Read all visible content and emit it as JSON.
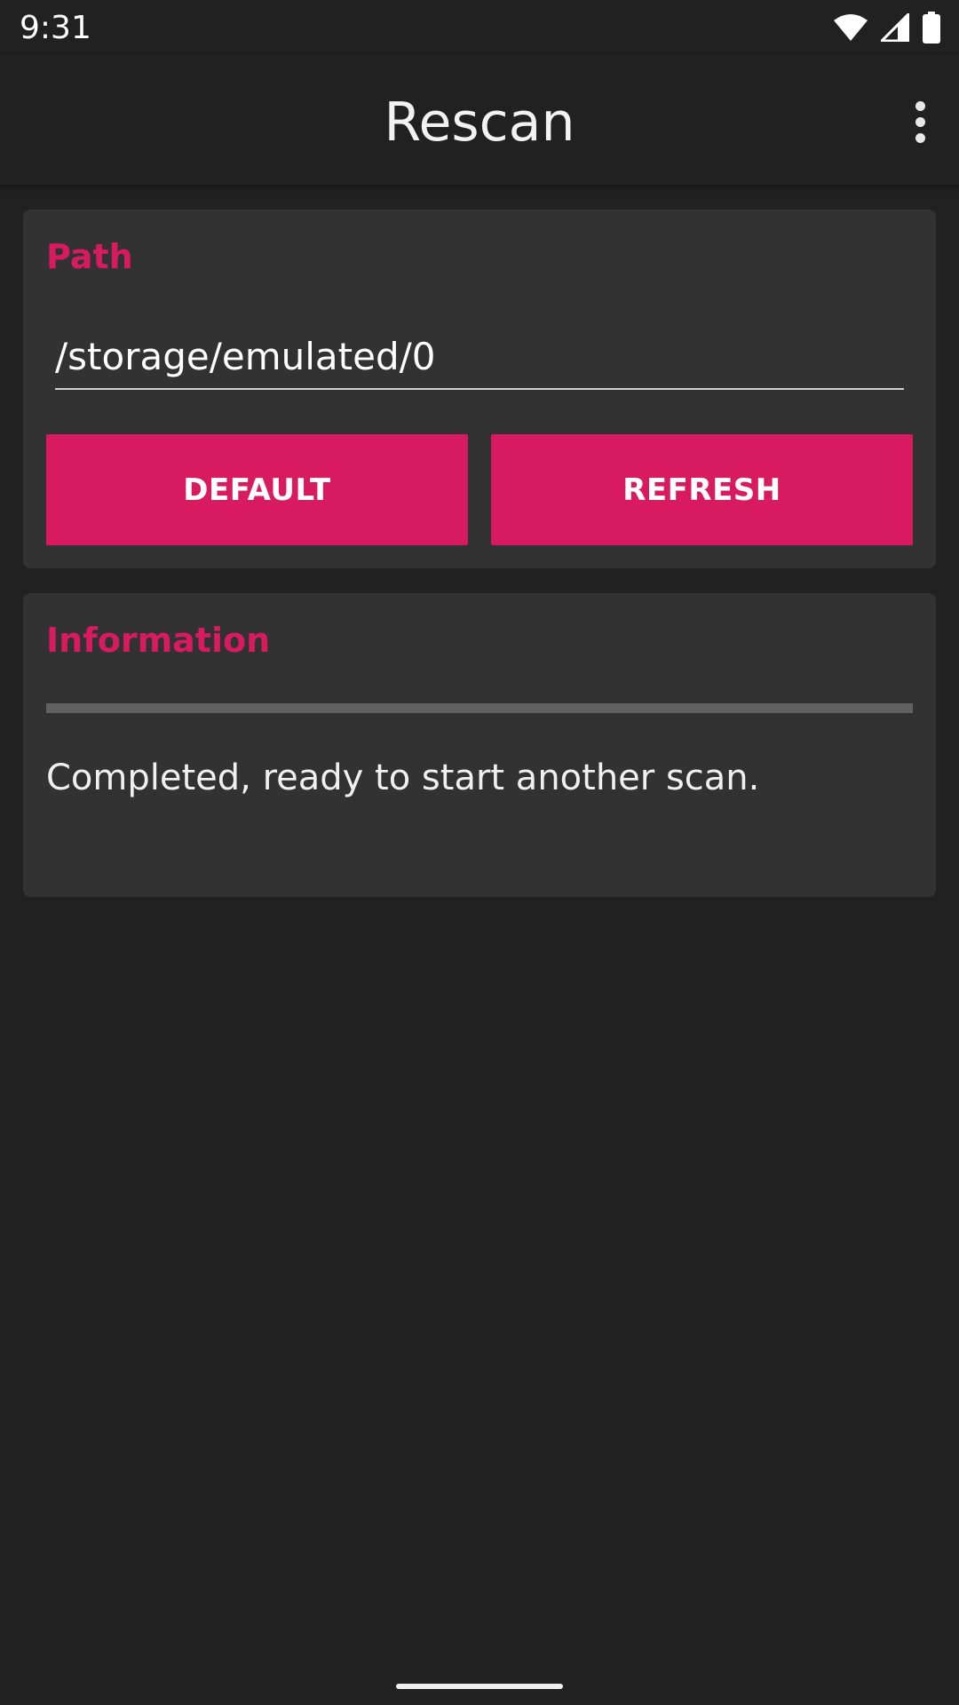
{
  "status_bar": {
    "time": "9:31",
    "icons": [
      "wifi-icon",
      "cell-signal-icon",
      "battery-icon"
    ]
  },
  "app_bar": {
    "title": "Rescan",
    "menu_icon": "more-vert-icon"
  },
  "path_card": {
    "title": "Path",
    "path_value": "/storage/emulated/0",
    "default_label": "DEFAULT",
    "refresh_label": "REFRESH"
  },
  "info_card": {
    "title": "Information",
    "progress": 0,
    "status_text": "Completed, ready to start another scan."
  },
  "colors": {
    "accent": "#d81b60",
    "background": "#212121",
    "card": "#323232"
  }
}
